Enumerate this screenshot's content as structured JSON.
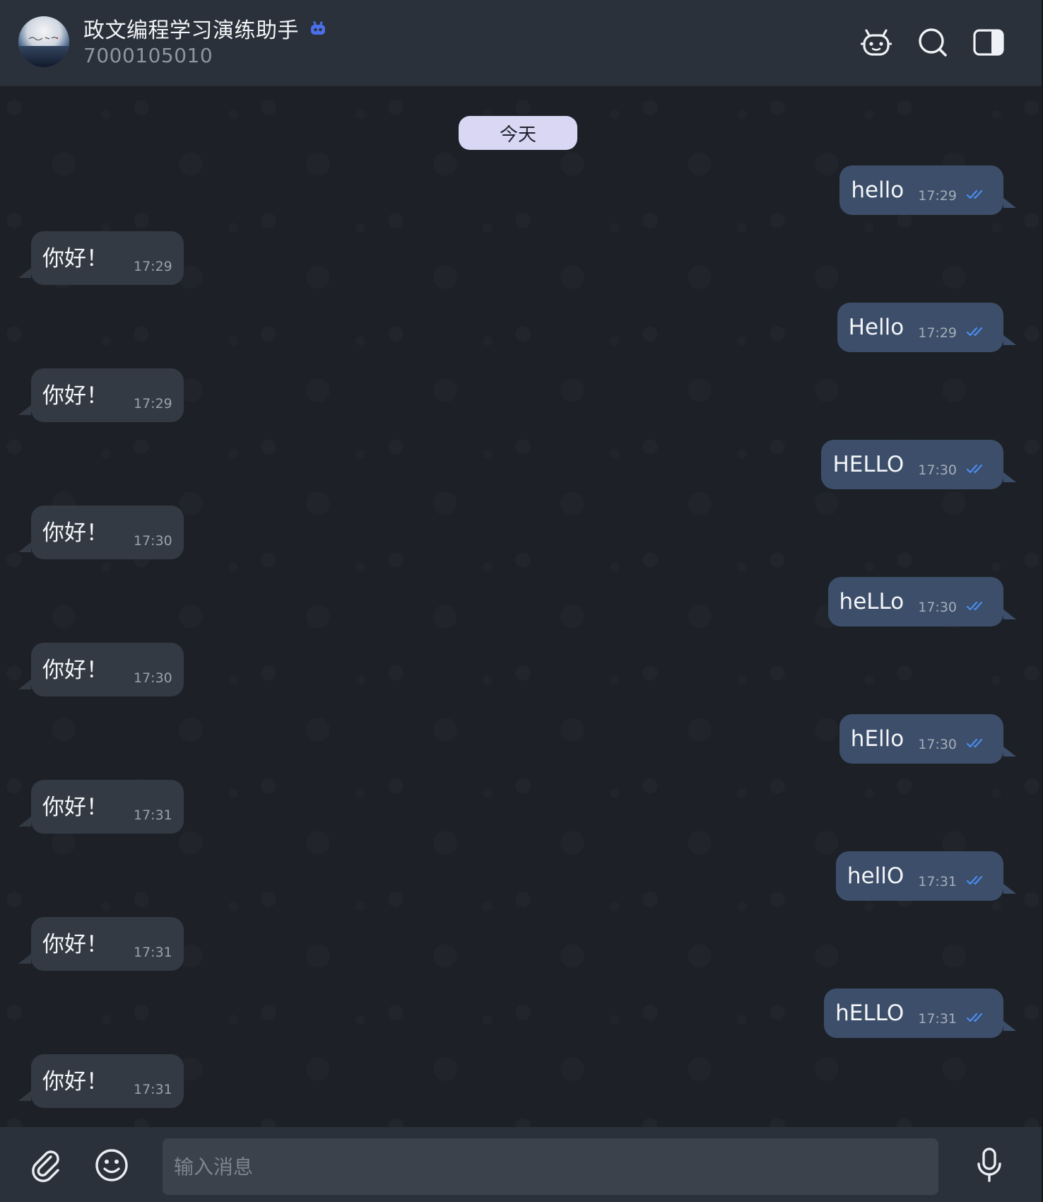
{
  "header": {
    "title": "政文编程学习演练助手",
    "subtitle": "7000105010",
    "bot_badge_icon": "bot-icon",
    "actions": [
      {
        "name": "bot-menu-button",
        "icon": "bot-face-icon"
      },
      {
        "name": "search-button",
        "icon": "search-icon"
      },
      {
        "name": "sidebar-toggle-button",
        "icon": "sidebar-icon"
      }
    ]
  },
  "chat": {
    "date_separator": "今天",
    "messages": [
      {
        "dir": "out",
        "text": "hello",
        "time": "17:29",
        "status": "read"
      },
      {
        "dir": "in",
        "text": "你好！",
        "time": "17:29"
      },
      {
        "dir": "out",
        "text": "Hello",
        "time": "17:29",
        "status": "read"
      },
      {
        "dir": "in",
        "text": "你好！",
        "time": "17:29"
      },
      {
        "dir": "out",
        "text": "HELLO",
        "time": "17:30",
        "status": "read"
      },
      {
        "dir": "in",
        "text": "你好！",
        "time": "17:30"
      },
      {
        "dir": "out",
        "text": "heLLo",
        "time": "17:30",
        "status": "read"
      },
      {
        "dir": "in",
        "text": "你好！",
        "time": "17:30"
      },
      {
        "dir": "out",
        "text": "hEllo",
        "time": "17:30",
        "status": "read"
      },
      {
        "dir": "in",
        "text": "你好！",
        "time": "17:31"
      },
      {
        "dir": "out",
        "text": "hellO",
        "time": "17:31",
        "status": "read"
      },
      {
        "dir": "in",
        "text": "你好！",
        "time": "17:31"
      },
      {
        "dir": "out",
        "text": "hELLO",
        "time": "17:31",
        "status": "read"
      },
      {
        "dir": "in",
        "text": "你好！",
        "time": "17:31"
      }
    ]
  },
  "composer": {
    "placeholder": "输入消息",
    "value": "",
    "attach_icon": "paperclip-icon",
    "emoji_icon": "emoji-icon",
    "mic_icon": "microphone-icon"
  },
  "colors": {
    "header_bg": "#2b313a",
    "chat_bg": "#1d2127",
    "outgoing_bubble": "#3c4e69",
    "incoming_bubble": "#343a43",
    "date_pill_bg": "#d9d7f3",
    "read_check": "#4a8df0",
    "bot_badge": "#4a6fe8"
  }
}
